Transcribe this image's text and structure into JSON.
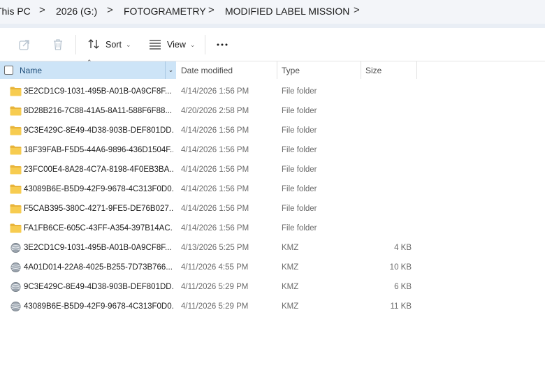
{
  "breadcrumb": {
    "items": [
      "This PC",
      "2026 (G:)",
      "FOTOGRAMETRY",
      "MODIFIED LABEL MISSION"
    ],
    "separator": ">"
  },
  "toolbar": {
    "share_icon": "share-icon",
    "delete_icon": "trash-icon",
    "sort_label": "Sort",
    "view_label": "View",
    "more_icon": "more-icon"
  },
  "columns": {
    "name": "Name",
    "date": "Date modified",
    "type": "Type",
    "size": "Size"
  },
  "colors": {
    "selected_header": "#cde4f7",
    "folder": "#f4c542",
    "breadcrumb_bg": "#f3f5f9"
  },
  "files": [
    {
      "name": "3E2CD1C9-1031-495B-A01B-0A9CF8F...",
      "date": "4/14/2026 1:56 PM",
      "type": "File folder",
      "size": "",
      "icon": "folder-icon"
    },
    {
      "name": "8D28B216-7C88-41A5-8A11-588F6F88...",
      "date": "4/20/2026 2:58 PM",
      "type": "File folder",
      "size": "",
      "icon": "folder-icon"
    },
    {
      "name": "9C3E429C-8E49-4D38-903B-DEF801DD...",
      "date": "4/14/2026 1:56 PM",
      "type": "File folder",
      "size": "",
      "icon": "folder-icon"
    },
    {
      "name": "18F39FAB-F5D5-44A6-9896-436D1504F...",
      "date": "4/14/2026 1:56 PM",
      "type": "File folder",
      "size": "",
      "icon": "folder-icon"
    },
    {
      "name": "23FC00E4-8A28-4C7A-8198-4F0EB3BA...",
      "date": "4/14/2026 1:56 PM",
      "type": "File folder",
      "size": "",
      "icon": "folder-icon"
    },
    {
      "name": "43089B6E-B5D9-42F9-9678-4C313F0D0...",
      "date": "4/14/2026 1:56 PM",
      "type": "File folder",
      "size": "",
      "icon": "folder-icon"
    },
    {
      "name": "F5CAB395-380C-4271-9FE5-DE76B027...",
      "date": "4/14/2026 1:56 PM",
      "type": "File folder",
      "size": "",
      "icon": "folder-icon"
    },
    {
      "name": "FA1FB6CE-605C-43FF-A354-397B14AC...",
      "date": "4/14/2026 1:56 PM",
      "type": "File folder",
      "size": "",
      "icon": "folder-icon"
    },
    {
      "name": "3E2CD1C9-1031-495B-A01B-0A9CF8F...",
      "date": "4/13/2026 5:25 PM",
      "type": "KMZ",
      "size": "4 KB",
      "icon": "kmz-globe-icon"
    },
    {
      "name": "4A01D014-22A8-4025-B255-7D73B766...",
      "date": "4/11/2026 4:55 PM",
      "type": "KMZ",
      "size": "10 KB",
      "icon": "kmz-globe-icon"
    },
    {
      "name": "9C3E429C-8E49-4D38-903B-DEF801DD...",
      "date": "4/11/2026 5:29 PM",
      "type": "KMZ",
      "size": "6 KB",
      "icon": "kmz-globe-icon"
    },
    {
      "name": "43089B6E-B5D9-42F9-9678-4C313F0D0...",
      "date": "4/11/2026 5:29 PM",
      "type": "KMZ",
      "size": "11 KB",
      "icon": "kmz-globe-icon"
    }
  ]
}
